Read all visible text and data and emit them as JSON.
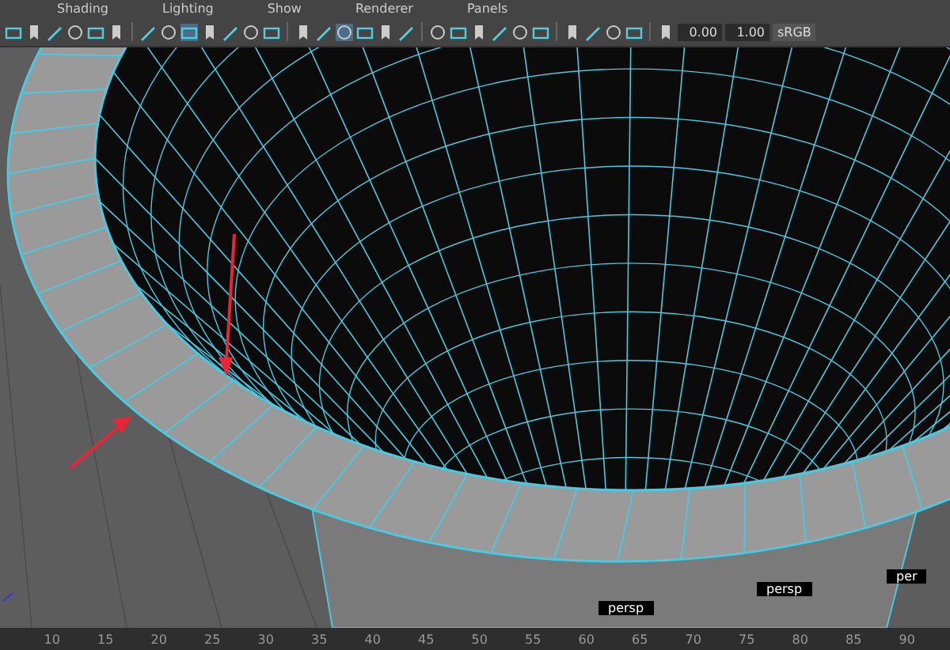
{
  "menu_bar": [
    "Shading",
    "Lighting",
    "Show",
    "Renderer",
    "Panels"
  ],
  "toolbar": {
    "exposure": "0.00",
    "gamma": "1.00",
    "color_space": "sRGB"
  },
  "viewport": {
    "labels": [
      "persp",
      "persp",
      "per"
    ]
  },
  "timeline": {
    "ticks": [
      "10",
      "15",
      "20",
      "25",
      "30",
      "35",
      "40",
      "45",
      "50",
      "55",
      "60",
      "65",
      "70",
      "75",
      "80",
      "85",
      "90"
    ]
  }
}
